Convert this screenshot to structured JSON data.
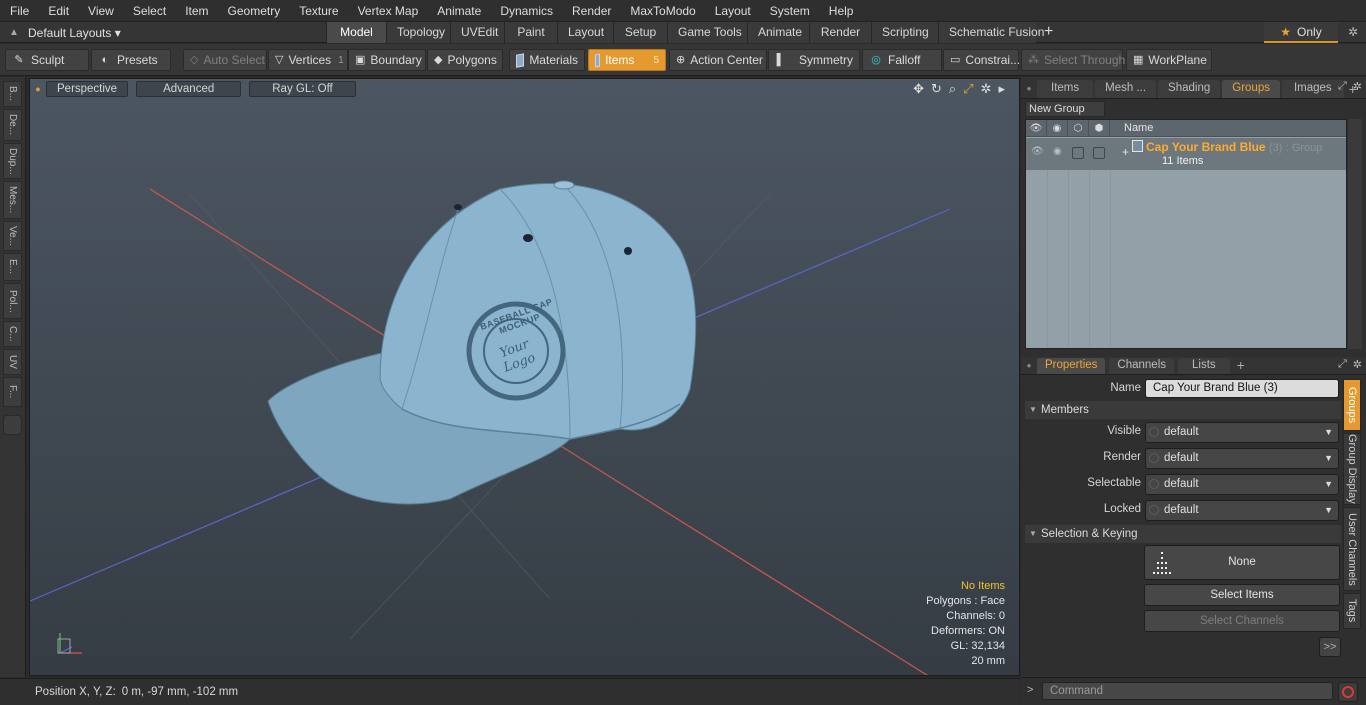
{
  "menu": [
    "File",
    "Edit",
    "View",
    "Select",
    "Item",
    "Geometry",
    "Texture",
    "Vertex Map",
    "Animate",
    "Dynamics",
    "Render",
    "MaxToModo",
    "Layout",
    "System",
    "Help"
  ],
  "layout_selector": "Default Layouts ▾",
  "layout_tabs": [
    "Model",
    "Topology",
    "UVEdit",
    "Paint",
    "Layout",
    "Setup",
    "Game Tools",
    "Animate",
    "Render",
    "Scripting",
    "Schematic Fusion"
  ],
  "layout_active": "Model",
  "only_label": "Only",
  "toolbar": {
    "sculpt": "Sculpt",
    "presets": "Presets",
    "auto_select": "Auto Select",
    "vertices": "Vertices",
    "vertices_count": "1",
    "boundary": "Boundary",
    "polygons": "Polygons",
    "materials": "Materials",
    "items": "Items",
    "items_count": "5",
    "action_center": "Action Center",
    "symmetry": "Symmetry",
    "falloff": "Falloff",
    "constraints": "Constrai...",
    "select_through": "Select Through",
    "workplane": "WorkPlane"
  },
  "left_tabs": [
    "B...",
    "De...",
    "Dup...",
    "Mes...",
    "Ve...",
    "E...",
    "Pol...",
    "C...",
    "UV",
    "F..."
  ],
  "viewport": {
    "view": "Perspective",
    "shading": "Advanced",
    "raygl": "Ray GL: Off",
    "info": {
      "selection": "No Items",
      "polygons": "Polygons : Face",
      "channels": "Channels: 0",
      "deformers": "Deformers: ON",
      "gl": "GL: 32,134",
      "scale": "20 mm"
    },
    "logo_top": "BASEBALL CAP MOCKUP",
    "logo_center": "Your Logo"
  },
  "status": {
    "label": "Position X, Y, Z:",
    "value": "0 m, -97 mm, -102 mm"
  },
  "panel_tabs": [
    "Items",
    "Mesh ...",
    "Shading",
    "Groups",
    "Images"
  ],
  "panel_active": "Groups",
  "new_group": "New Group",
  "group_list": {
    "col_name": "Name",
    "group_name": "Cap Your Brand Blue",
    "group_count": "(3)",
    "group_type": ": Group",
    "group_items": "11 Items"
  },
  "prop_tabs": [
    "Properties",
    "Channels",
    "Lists"
  ],
  "prop_active": "Properties",
  "props": {
    "name_label": "Name",
    "name_value": "Cap Your Brand Blue (3)",
    "members": "Members",
    "visible_label": "Visible",
    "visible_value": "default",
    "render_label": "Render",
    "render_value": "default",
    "selectable_label": "Selectable",
    "selectable_value": "default",
    "locked_label": "Locked",
    "locked_value": "default",
    "sel_keying": "Selection & Keying",
    "none_btn": "None",
    "select_items": "Select Items",
    "select_channels": "Select Channels",
    "more": ">>"
  },
  "prop_vtabs": [
    "Groups",
    "Group Display",
    "User Channels",
    "Tags"
  ],
  "command_placeholder": "Command"
}
